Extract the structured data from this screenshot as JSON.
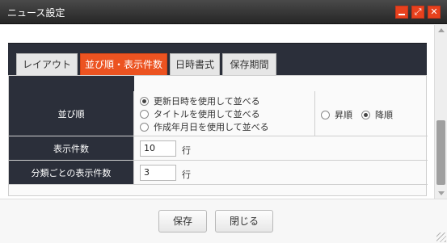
{
  "window": {
    "title": "ニュース設定",
    "buttons": {
      "minimize": "–",
      "maximize": "⤢",
      "close": "✕"
    },
    "accent_color": "#e8411d"
  },
  "tabs": [
    {
      "label": "レイアウト",
      "active": false
    },
    {
      "label": "並び順・表示件数",
      "active": true
    },
    {
      "label": "日時書式",
      "active": false
    },
    {
      "label": "保存期間",
      "active": false
    }
  ],
  "form": {
    "sort": {
      "label": "並び順",
      "options": [
        {
          "label": "更新日時を使用して並べる",
          "selected": true
        },
        {
          "label": "タイトルを使用して並べる",
          "selected": false
        },
        {
          "label": "作成年月日を使用して並べる",
          "selected": false
        }
      ],
      "direction": [
        {
          "label": "昇順",
          "selected": false
        },
        {
          "label": "降順",
          "selected": true
        }
      ]
    },
    "count": {
      "label": "表示件数",
      "value": "10",
      "unit": "行"
    },
    "per_category": {
      "label": "分類ごとの表示件数",
      "value": "3",
      "unit": "行"
    }
  },
  "footer": {
    "save": "保存",
    "close": "閉じる"
  }
}
